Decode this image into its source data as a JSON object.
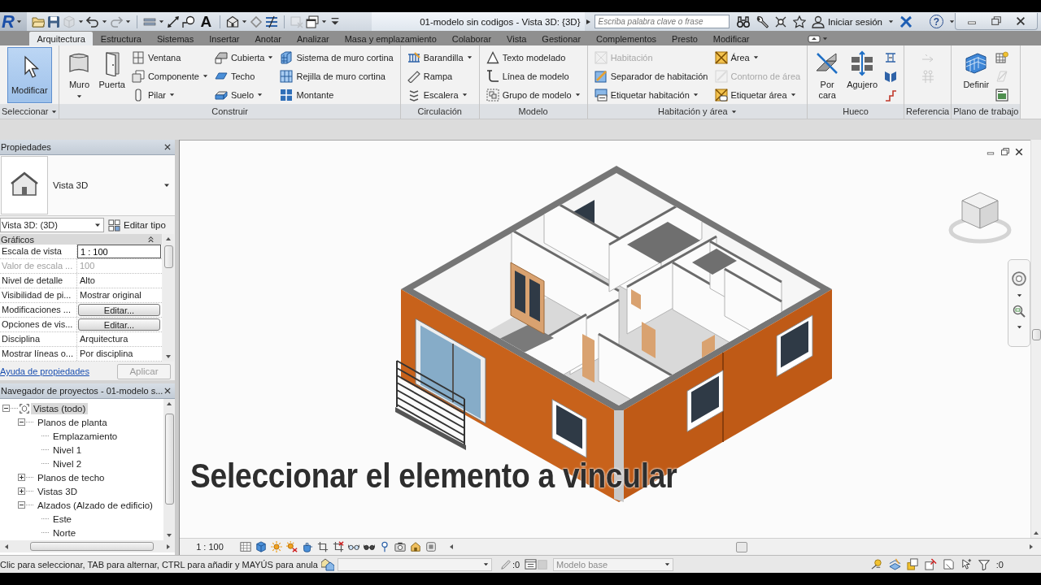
{
  "title_bar": {
    "logo": "R",
    "text_tool": "A",
    "title": "01-modelo sin codigos - Vista 3D: {3D}",
    "search": {
      "placeholder": "Escriba palabra clave o frase"
    },
    "sign_in": "Iniciar sesión",
    "help": "?"
  },
  "ribbon": {
    "tabs": [
      {
        "label": "Arquitectura",
        "selected": true
      },
      {
        "label": "Estructura",
        "selected": false
      },
      {
        "label": "Sistemas",
        "selected": false
      },
      {
        "label": "Insertar",
        "selected": false
      },
      {
        "label": "Anotar",
        "selected": false
      },
      {
        "label": "Analizar",
        "selected": false
      },
      {
        "label": "Masa y emplazamiento",
        "selected": false
      },
      {
        "label": "Colaborar",
        "selected": false
      },
      {
        "label": "Vista",
        "selected": false
      },
      {
        "label": "Gestionar",
        "selected": false
      },
      {
        "label": "Complementos",
        "selected": false
      },
      {
        "label": "Presto",
        "selected": false
      },
      {
        "label": "Modificar",
        "selected": false
      }
    ],
    "panels": [
      {
        "title": "Seleccionar",
        "menu": true,
        "columns": [
          [
            {
              "kind": "large",
              "label": "Modificar",
              "dropdown": false,
              "disabled": false,
              "selected": true
            }
          ]
        ]
      },
      {
        "title": "Construir",
        "menu": false,
        "columns": [
          [
            {
              "kind": "large",
              "label": "Muro",
              "dropdown": true,
              "disabled": false,
              "selected": false
            }
          ],
          [
            {
              "kind": "large",
              "label": "Puerta",
              "dropdown": false,
              "disabled": false,
              "selected": false
            }
          ],
          [
            {
              "kind": "small",
              "label": "Ventana",
              "dropdown": false,
              "disabled": false,
              "selected": false
            },
            {
              "kind": "small",
              "label": "Componente",
              "dropdown": true,
              "disabled": false,
              "selected": false
            },
            {
              "kind": "small",
              "label": "Pilar",
              "dropdown": true,
              "disabled": false,
              "selected": false
            }
          ],
          [
            {
              "kind": "small",
              "label": "Cubierta",
              "dropdown": true,
              "disabled": false,
              "selected": false
            },
            {
              "kind": "small",
              "label": "Techo",
              "dropdown": false,
              "disabled": false,
              "selected": false
            },
            {
              "kind": "small",
              "label": "Suelo",
              "dropdown": true,
              "disabled": false,
              "selected": false
            }
          ],
          [
            {
              "kind": "small",
              "label": "Sistema de muro cortina",
              "dropdown": false,
              "disabled": false,
              "selected": false
            },
            {
              "kind": "small",
              "label": "Rejilla de muro cortina",
              "dropdown": false,
              "disabled": false,
              "selected": false
            },
            {
              "kind": "small",
              "label": "Montante",
              "dropdown": false,
              "disabled": false,
              "selected": false
            }
          ]
        ]
      },
      {
        "title": "Circulación",
        "menu": false,
        "columns": [
          [
            {
              "kind": "small",
              "label": "Barandilla",
              "dropdown": true,
              "disabled": false,
              "selected": false
            },
            {
              "kind": "small",
              "label": "Rampa",
              "dropdown": false,
              "disabled": false,
              "selected": false
            },
            {
              "kind": "small",
              "label": "Escalera",
              "dropdown": true,
              "disabled": false,
              "selected": false
            }
          ]
        ]
      },
      {
        "title": "Modelo",
        "menu": false,
        "columns": [
          [
            {
              "kind": "small",
              "label": "Texto modelado",
              "dropdown": false,
              "disabled": false,
              "selected": false
            },
            {
              "kind": "small",
              "label": "Línea de modelo",
              "dropdown": false,
              "disabled": false,
              "selected": false
            },
            {
              "kind": "small",
              "label": "Grupo de modelo",
              "dropdown": true,
              "disabled": false,
              "selected": false
            }
          ]
        ]
      },
      {
        "title": "Habitación y área",
        "menu": true,
        "columns": [
          [
            {
              "kind": "small",
              "label": "Habitación",
              "dropdown": false,
              "disabled": true,
              "selected": false
            },
            {
              "kind": "small",
              "label": "Separador de habitación",
              "dropdown": false,
              "disabled": false,
              "selected": false
            },
            {
              "kind": "small",
              "label": "Etiquetar habitación",
              "dropdown": true,
              "disabled": false,
              "selected": false
            }
          ],
          [
            {
              "kind": "small",
              "label": "Área",
              "dropdown": true,
              "disabled": false,
              "selected": false
            },
            {
              "kind": "small",
              "label": "Contorno de área",
              "dropdown": false,
              "disabled": true,
              "selected": false
            },
            {
              "kind": "small",
              "label": "Etiquetar área",
              "dropdown": true,
              "disabled": false,
              "selected": false
            }
          ]
        ]
      },
      {
        "title": "Hueco",
        "menu": false,
        "columns": [
          [
            {
              "kind": "large",
              "label": "Por cara",
              "dropdown": false,
              "disabled": false,
              "selected": false
            }
          ],
          [
            {
              "kind": "large",
              "label": "Agujero",
              "dropdown": false,
              "disabled": false,
              "selected": false
            }
          ],
          [
            {
              "kind": "icon",
              "dropdown": false,
              "disabled": false,
              "selected": false
            },
            {
              "kind": "icon",
              "dropdown": false,
              "disabled": false,
              "selected": false
            },
            {
              "kind": "icon",
              "dropdown": false,
              "disabled": false,
              "selected": false
            }
          ]
        ]
      },
      {
        "title": "Referencia",
        "menu": false,
        "columns": [
          [
            {
              "kind": "icon",
              "dropdown": false,
              "disabled": true,
              "selected": false
            },
            {
              "kind": "icon",
              "dropdown": false,
              "disabled": true,
              "selected": false
            }
          ]
        ]
      },
      {
        "title": "Plano de trabajo",
        "menu": false,
        "columns": [
          [
            {
              "kind": "large",
              "label": "Definir",
              "dropdown": false,
              "disabled": false,
              "selected": false
            }
          ],
          [
            {
              "kind": "icon",
              "dropdown": false,
              "disabled": false,
              "selected": false
            },
            {
              "kind": "icon",
              "dropdown": false,
              "disabled": true,
              "selected": false
            },
            {
              "kind": "icon",
              "dropdown": false,
              "disabled": false,
              "selected": false
            }
          ]
        ]
      }
    ]
  },
  "properties": {
    "title": "Propiedades",
    "type_name": "Vista 3D",
    "instance": "Vista 3D: (3D)",
    "edit_type": "Editar tipo",
    "group": "Gráficos",
    "rows": [
      {
        "name": "Escala de vista",
        "value": "1 : 100",
        "kind": "input",
        "disabled": false
      },
      {
        "name": "Valor de escala ...",
        "value": "100",
        "kind": "text",
        "disabled": true
      },
      {
        "name": "Nivel de detalle",
        "value": "Alto",
        "kind": "text",
        "disabled": false
      },
      {
        "name": "Visibilidad de pi...",
        "value": "Mostrar original",
        "kind": "text",
        "disabled": false
      },
      {
        "name": "Modificaciones ...",
        "value": "Editar...",
        "kind": "button",
        "disabled": false
      },
      {
        "name": "Opciones de vis...",
        "value": "Editar...",
        "kind": "button",
        "disabled": false
      },
      {
        "name": "Disciplina",
        "value": "Arquitectura",
        "kind": "text",
        "disabled": false
      },
      {
        "name": "Mostrar líneas o...",
        "value": "Por disciplina",
        "kind": "text",
        "disabled": false
      }
    ],
    "help_link": "Ayuda de propiedades",
    "apply": {
      "label": "Aplicar",
      "disabled": true
    }
  },
  "project_browser": {
    "title": "Navegador de proyectos - 01-modelo s...",
    "tree": [
      {
        "label": "Vistas (todo)",
        "expanded": true,
        "selected": true,
        "children": [
          {
            "label": "Planos de planta",
            "expanded": true,
            "selected": false,
            "children": [
              {
                "label": "Emplazamiento",
                "selected": false
              },
              {
                "label": "Nivel 1",
                "selected": false
              },
              {
                "label": "Nivel 2",
                "selected": false
              }
            ]
          },
          {
            "label": "Planos de techo",
            "expanded": false,
            "selected": false
          },
          {
            "label": "Vistas 3D",
            "expanded": false,
            "selected": false
          },
          {
            "label": "Alzados (Alzado de edificio)",
            "expanded": true,
            "selected": false,
            "children": [
              {
                "label": "Este",
                "selected": false
              },
              {
                "label": "Norte",
                "selected": false
              }
            ]
          }
        ]
      }
    ]
  },
  "viewport": {
    "caption": "Seleccionar el elemento a vincular",
    "scale": "1 : 100"
  },
  "status_bar": {
    "message": "Clic para seleccionar, TAB para alternar, CTRL para añadir y MAYÚS para anula",
    "selection_count": ":0",
    "active_workset": "Modelo base",
    "filter_count": ":0"
  }
}
